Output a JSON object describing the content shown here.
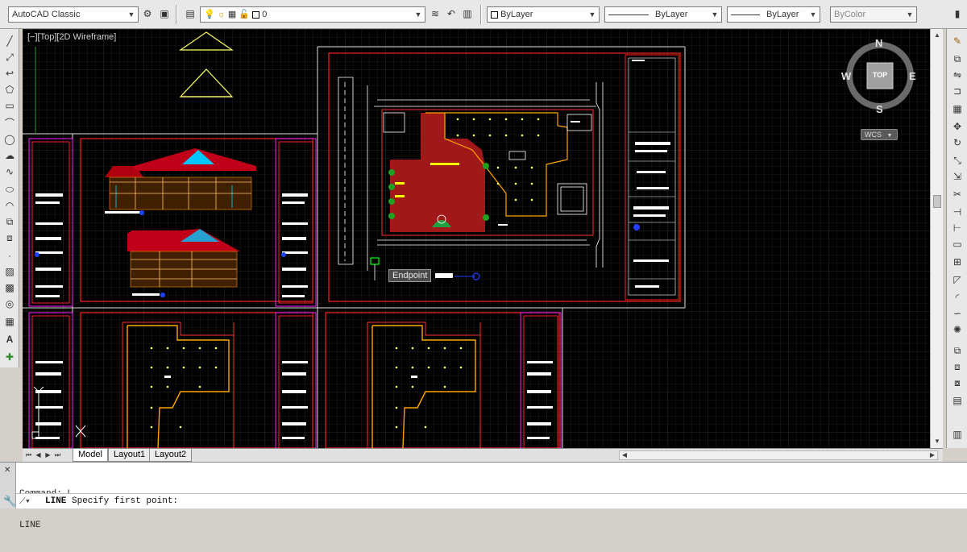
{
  "toolbar": {
    "workspace": "AutoCAD Classic",
    "layer_name": "0",
    "color": "ByLayer",
    "linetype": "ByLayer",
    "lineweight": "ByLayer",
    "plotstyle": "ByColor"
  },
  "viewport": {
    "label": "[−][Top][2D Wireframe]"
  },
  "viewcube": {
    "north": "N",
    "south": "S",
    "east": "E",
    "west": "W",
    "face": "TOP",
    "ucs_label": "WCS"
  },
  "snap_tooltip": "Endpoint",
  "tabs": [
    {
      "label": "Model",
      "active": true
    },
    {
      "label": "Layout1",
      "active": false
    },
    {
      "label": "Layout2",
      "active": false
    }
  ],
  "command": {
    "history": [
      "Command: L",
      "LINE"
    ],
    "prompt_command": "LINE",
    "prompt_text": " Specify first point:"
  },
  "colors": {
    "canvas": "#000000",
    "grid_minor": "#1c1c1c",
    "grid_major": "#2e2e2e",
    "sheet_border": "#ff0000",
    "title_block": "#ff00ff",
    "wall": "#ffa500",
    "text": "#ffffff",
    "tooltip_bg": "#4a4a4a"
  },
  "icons": {
    "left_toolbar": [
      "line-icon",
      "construction-line-icon",
      "polyline-icon",
      "polygon-icon",
      "rectangle-icon",
      "arc-icon",
      "circle-icon",
      "revcloud-icon",
      "spline-icon",
      "ellipse-icon",
      "ellipse-arc-icon",
      "insert-block-icon",
      "make-block-icon",
      "point-icon",
      "hatch-icon",
      "gradient-icon",
      "region-icon",
      "table-icon",
      "multiline-text-icon",
      "add-selected-icon"
    ],
    "right_toolbar": [
      "erase-icon",
      "copy-icon",
      "mirror-icon",
      "offset-icon",
      "array-icon",
      "move-icon",
      "rotate-icon",
      "scale-icon",
      "stretch-icon",
      "trim-icon",
      "extend-icon",
      "break-at-point-icon",
      "break-icon",
      "join-icon",
      "chamfer-icon",
      "fillet-icon",
      "blend-icon",
      "explode-icon",
      "draw-order-icon",
      "draw-order-front-icon",
      "draw-order-back-icon",
      "draw-order-above-icon",
      "draw-order-under-icon"
    ]
  }
}
